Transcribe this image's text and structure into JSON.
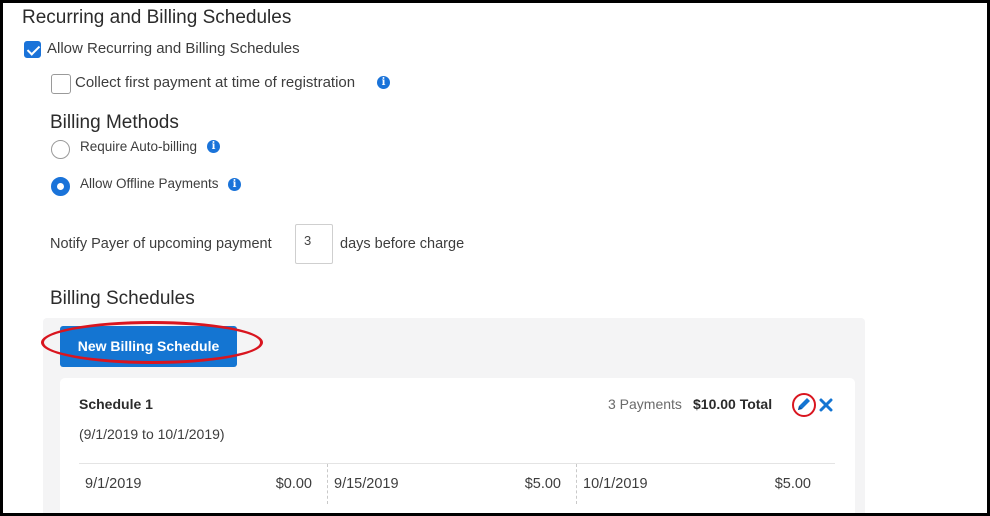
{
  "section": {
    "title": "Recurring and Billing Schedules"
  },
  "allow_recurring": {
    "label": "Allow Recurring and Billing Schedules",
    "checked": true
  },
  "collect_first": {
    "label": "Collect first payment at time of registration",
    "checked": false
  },
  "billing_methods": {
    "heading": "Billing Methods",
    "options": [
      {
        "label": "Require Auto-billing",
        "selected": false
      },
      {
        "label": "Allow Offline Payments",
        "selected": true
      }
    ]
  },
  "notify": {
    "prefix": "Notify Payer of upcoming payment",
    "days_value": "3",
    "suffix": "days before charge"
  },
  "billing_schedules": {
    "heading": "Billing Schedules",
    "new_button_label": "New Billing Schedule",
    "schedules": [
      {
        "name": "Schedule 1",
        "range": "(9/1/2019 to 10/1/2019)",
        "payments_count_text": "3 Payments",
        "total_text": "$10.00 Total",
        "payments": [
          {
            "date": "9/1/2019",
            "amount": "$0.00"
          },
          {
            "date": "9/15/2019",
            "amount": "$5.00"
          },
          {
            "date": "10/1/2019",
            "amount": "$5.00"
          }
        ]
      }
    ]
  },
  "colors": {
    "accent": "#1475d2",
    "highlight": "#d9151f"
  },
  "icons": {
    "info": "info-icon",
    "edit": "pencil-icon",
    "delete": "close-icon"
  }
}
